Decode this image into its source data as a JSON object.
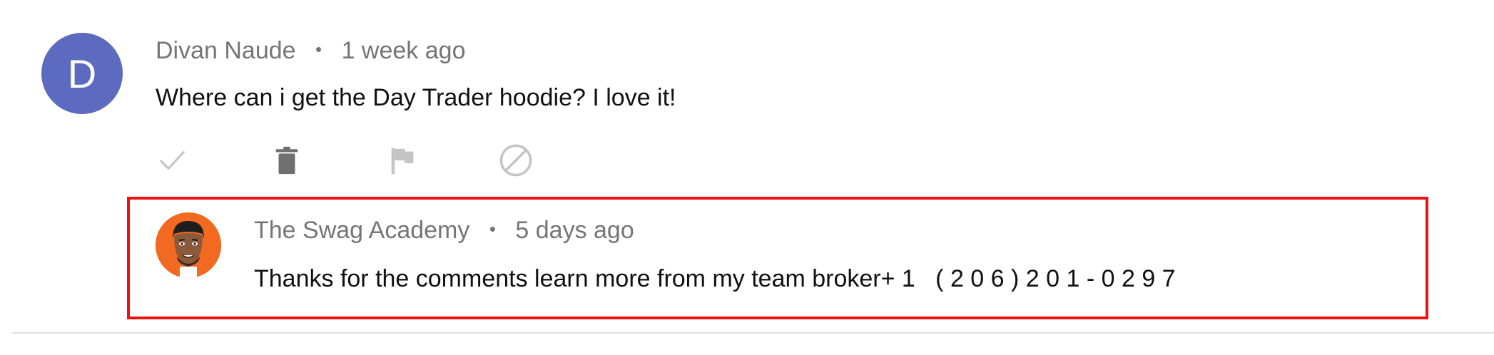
{
  "comment": {
    "avatar_letter": "D",
    "avatar_color": "#5c6bc0",
    "author": "Divan Naude",
    "separator": "•",
    "time": "1 week ago",
    "text": "Where can i get the Day Trader hoodie? I love it!",
    "actions": [
      {
        "name": "approve",
        "icon": "checkmark-icon"
      },
      {
        "name": "remove",
        "icon": "trash-icon"
      },
      {
        "name": "report",
        "icon": "flag-icon"
      },
      {
        "name": "hide-user",
        "icon": "block-icon"
      }
    ]
  },
  "reply": {
    "author": "The Swag Academy",
    "separator": "•",
    "time": "5 days ago",
    "text": "Thanks for the comments learn more from my team broker+ 1   ( 2 0 6 ) 2 0 1 - 0 2 9 7",
    "avatar_color": "#f26a21",
    "highlight_color": "#ee1111"
  }
}
